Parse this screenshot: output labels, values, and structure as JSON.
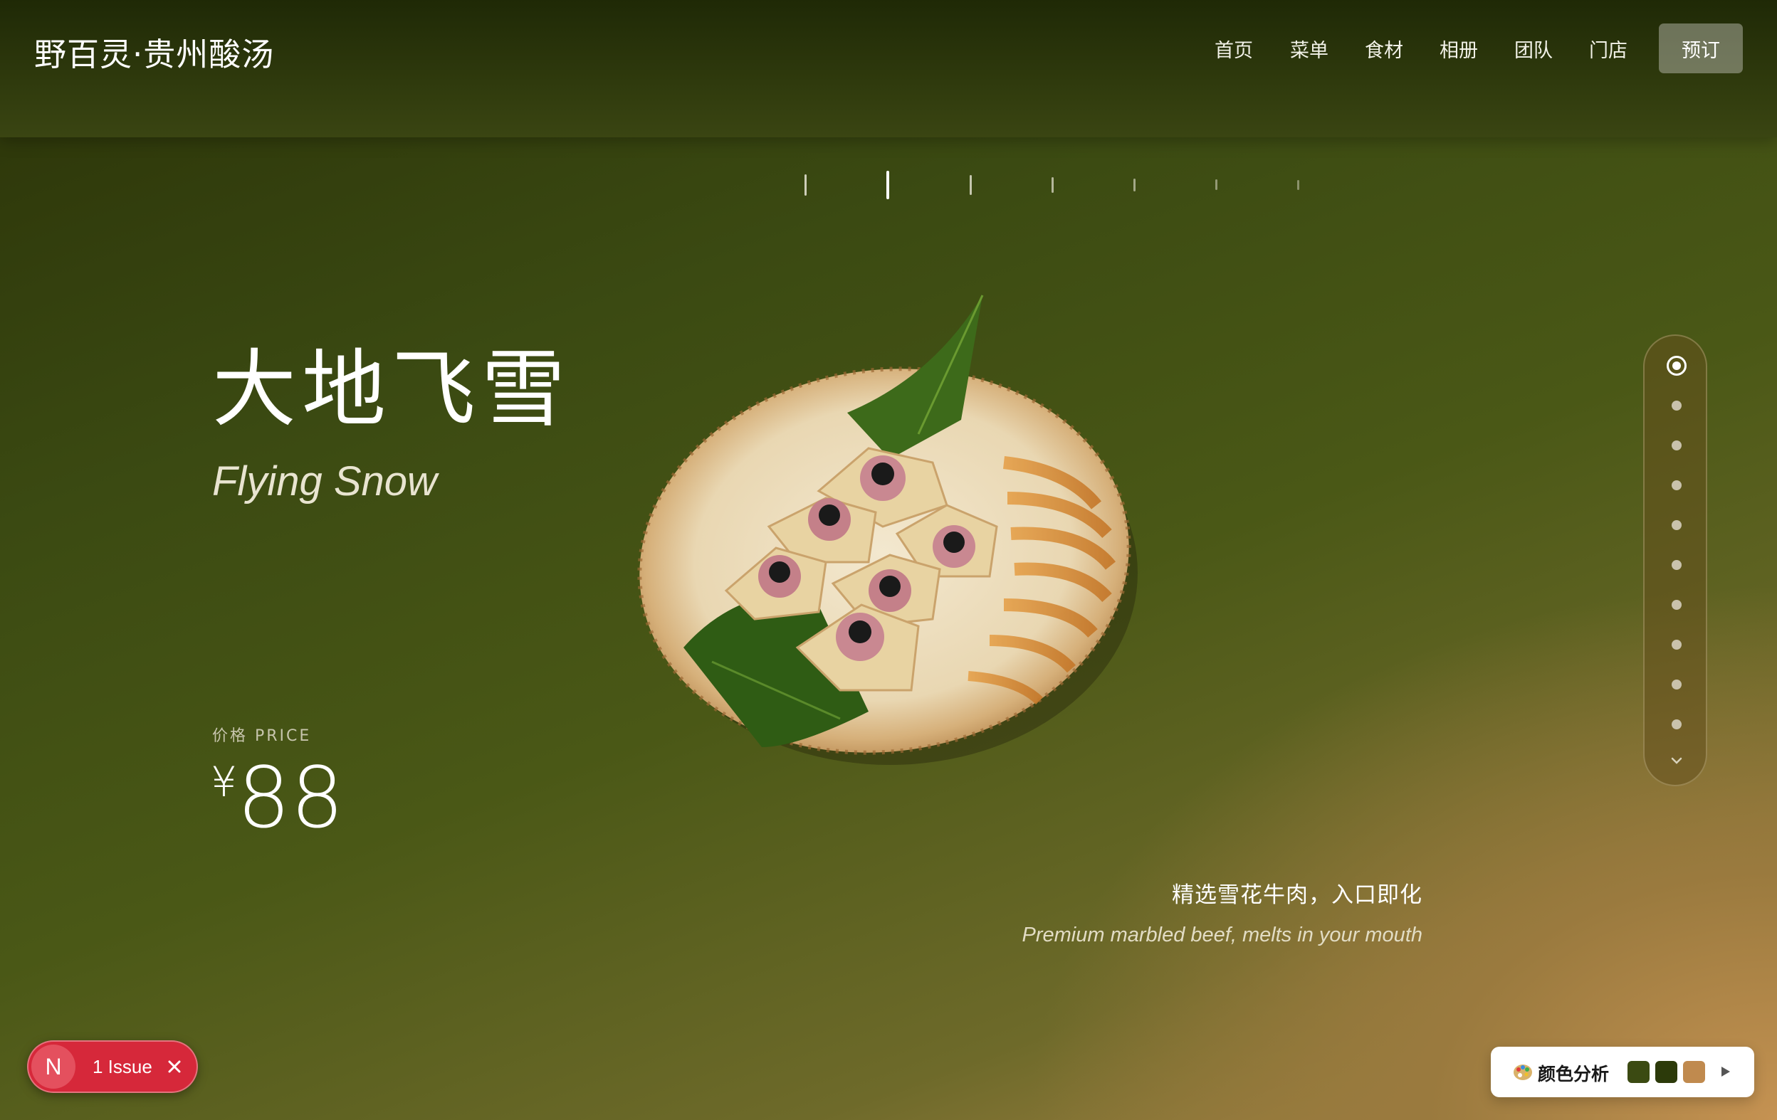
{
  "header": {
    "brand": "野百灵·贵州酸汤",
    "nav": [
      "首页",
      "菜单",
      "食材",
      "相册",
      "团队",
      "门店"
    ],
    "reserve_label": "预订"
  },
  "slider": {
    "count": 7,
    "active_index": 1
  },
  "dish": {
    "title_zh": "大地飞雪",
    "title_en": "Flying Snow",
    "price_label": "价格 PRICE",
    "currency": "¥",
    "price": "88",
    "desc_zh": "精选雪花牛肉，入口即化",
    "desc_en": "Premium marbled beef, melts in your mouth"
  },
  "side_nav": {
    "count": 10,
    "active_index": 0
  },
  "issue_badge": {
    "logo": "N",
    "label": "1 Issue"
  },
  "color_panel": {
    "label": "颜色分析",
    "swatches": [
      "#3b4a12",
      "#2c3a0a",
      "#c08a4e"
    ]
  },
  "colors": {
    "header_bg": "#243008",
    "issue_red": "#d6283a"
  }
}
